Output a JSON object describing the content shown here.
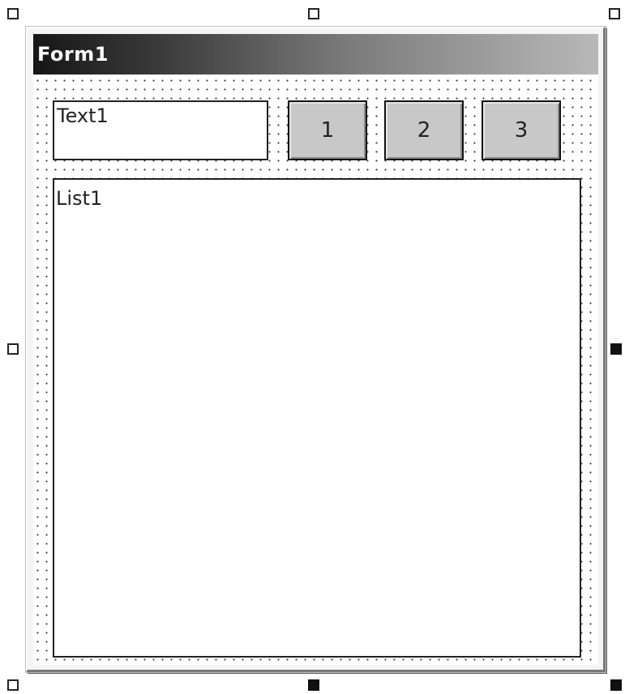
{
  "form": {
    "title": "Form1"
  },
  "controls": {
    "text1": {
      "text": "Text1"
    },
    "buttons": [
      {
        "caption": "1"
      },
      {
        "caption": "2"
      },
      {
        "caption": "3"
      }
    ],
    "list1": {
      "text": "List1"
    }
  }
}
